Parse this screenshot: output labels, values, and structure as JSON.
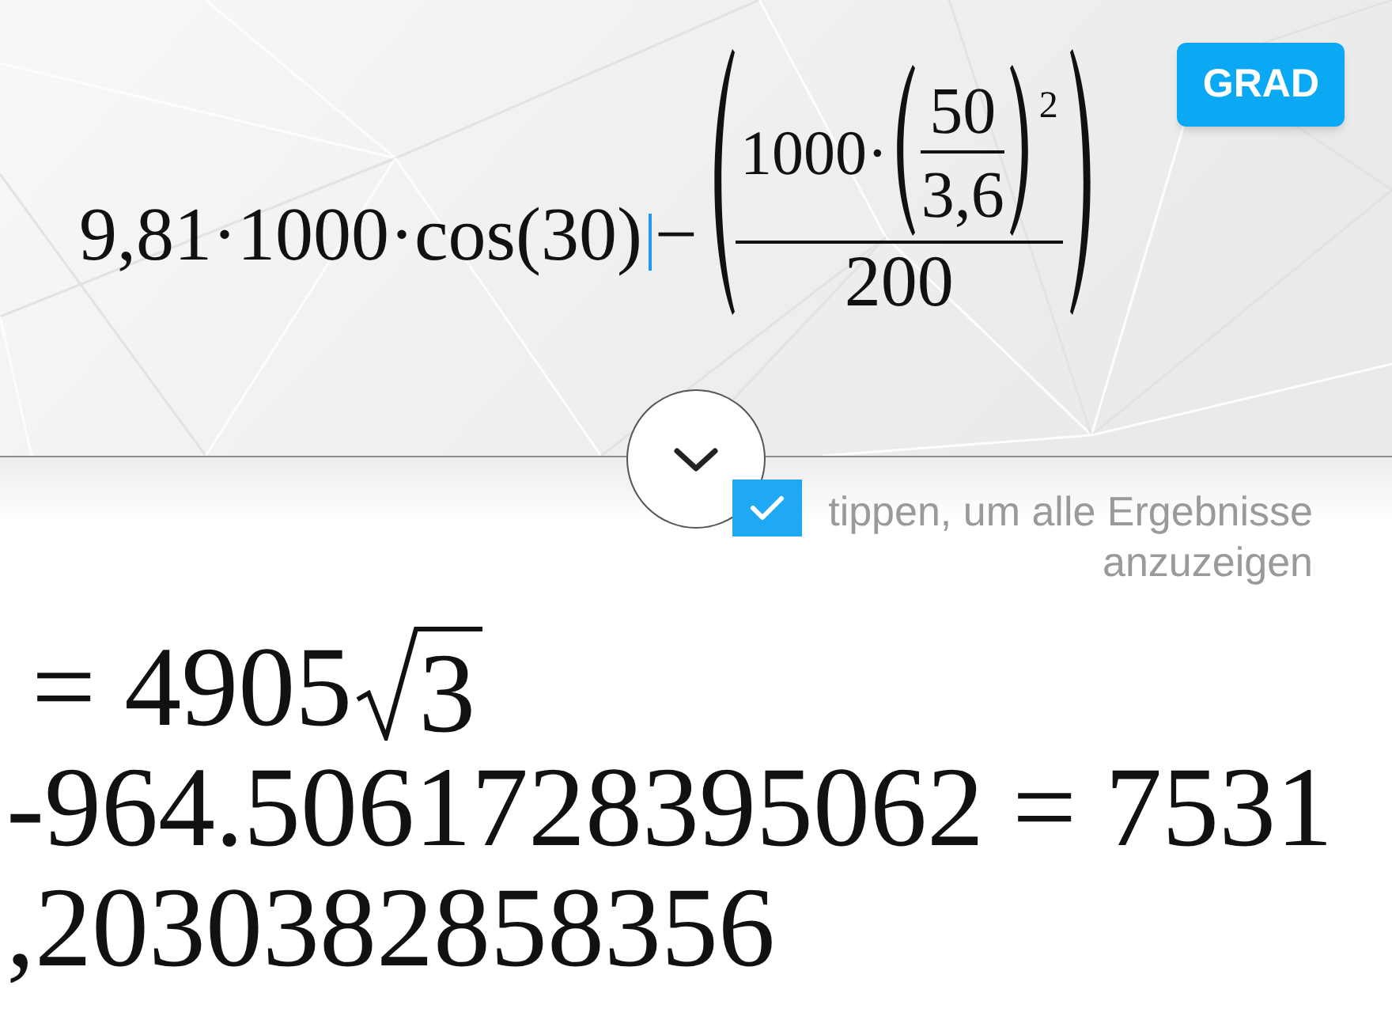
{
  "expression": {
    "lead": "9,81·1000·cos(30)",
    "operator": "−",
    "numerator_factor": "1000·",
    "inner_numerator": "50",
    "inner_denominator": "3,6",
    "exponent": "2",
    "denominator": "200"
  },
  "mode_button": {
    "label": "GRAD"
  },
  "show_all_results": {
    "label": "tippen, um alle Ergebnisse anzuzeigen",
    "checked": true
  },
  "result": {
    "exact": {
      "value": "= 4905",
      "radicand": "3"
    },
    "lines": [
      "-964.5061728395062 = 7531",
      ",2030382858356"
    ]
  }
}
